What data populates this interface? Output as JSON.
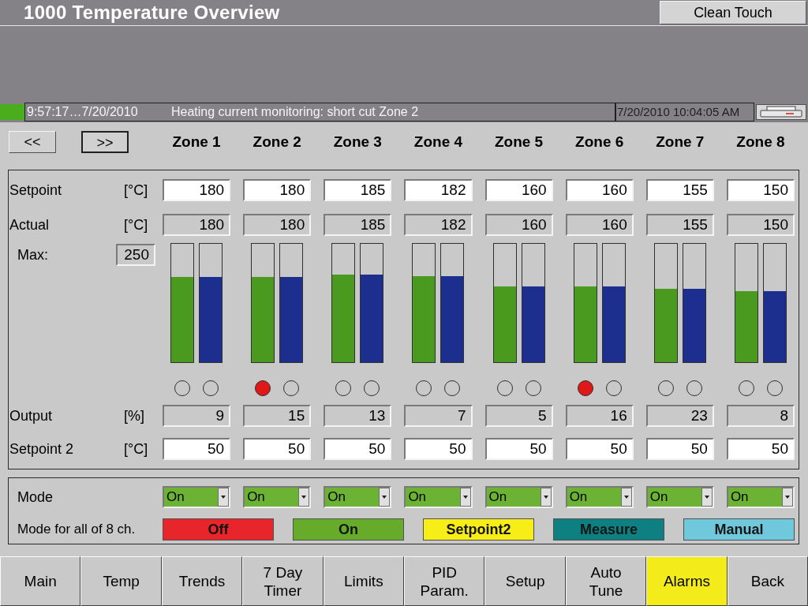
{
  "title_bar": {
    "title": "1000 Temperature Overview",
    "clean_touch_button": "Clean Touch"
  },
  "message_bar": {
    "time": "9:57:17…7/20/2010",
    "message": "Heating current monitoring: short cut Zone 2",
    "date_time": "7/20/2010 10:04:05 AM"
  },
  "page_buttons": [
    {
      "label": "<<",
      "selected": false
    },
    {
      "label": ">>",
      "selected": true
    }
  ],
  "row_labels": {
    "setpoint": {
      "label": "Setpoint",
      "unit": "[°C]"
    },
    "actual": {
      "label": "Actual",
      "unit": "[°C]"
    },
    "output": {
      "label": "Output",
      "unit": "[%]"
    },
    "setpoint_2": {
      "label": "Setpoint 2",
      "unit": "[°C]"
    }
  },
  "max": {
    "label": "Max:",
    "value": "250"
  },
  "zones": [
    {
      "name": "Zone 1",
      "setpoint": "180",
      "actual": "180",
      "bars": [
        {
          "level": 0.72,
          "color": "#4a9a20"
        },
        {
          "level": 0.72,
          "color": "#1c2f8e"
        }
      ],
      "lights": [
        {
          "on": false
        },
        {
          "on": false
        }
      ],
      "output": "9",
      "setpoint_2": "50",
      "mode": "On"
    },
    {
      "name": "Zone 2",
      "setpoint": "180",
      "actual": "180",
      "bars": [
        {
          "level": 0.72,
          "color": "#4a9a20"
        },
        {
          "level": 0.72,
          "color": "#1c2f8e"
        }
      ],
      "lights": [
        {
          "on": true
        },
        {
          "on": false
        }
      ],
      "output": "15",
      "setpoint_2": "50",
      "mode": "On"
    },
    {
      "name": "Zone 3",
      "setpoint": "185",
      "actual": "185",
      "bars": [
        {
          "level": 0.74,
          "color": "#4a9a20"
        },
        {
          "level": 0.74,
          "color": "#1c2f8e"
        }
      ],
      "lights": [
        {
          "on": false
        },
        {
          "on": false
        }
      ],
      "output": "13",
      "setpoint_2": "50",
      "mode": "On"
    },
    {
      "name": "Zone 4",
      "setpoint": "182",
      "actual": "182",
      "bars": [
        {
          "level": 0.73,
          "color": "#4a9a20"
        },
        {
          "level": 0.73,
          "color": "#1c2f8e"
        }
      ],
      "lights": [
        {
          "on": false
        },
        {
          "on": false
        }
      ],
      "output": "7",
      "setpoint_2": "50",
      "mode": "On"
    },
    {
      "name": "Zone 5",
      "setpoint": "160",
      "actual": "160",
      "bars": [
        {
          "level": 0.64,
          "color": "#4a9a20"
        },
        {
          "level": 0.64,
          "color": "#1c2f8e"
        }
      ],
      "lights": [
        {
          "on": false
        },
        {
          "on": false
        }
      ],
      "output": "5",
      "setpoint_2": "50",
      "mode": "On"
    },
    {
      "name": "Zone 6",
      "setpoint": "160",
      "actual": "160",
      "bars": [
        {
          "level": 0.64,
          "color": "#4a9a20"
        },
        {
          "level": 0.64,
          "color": "#1c2f8e"
        }
      ],
      "lights": [
        {
          "on": true
        },
        {
          "on": false
        }
      ],
      "output": "16",
      "setpoint_2": "50",
      "mode": "On"
    },
    {
      "name": "Zone 7",
      "setpoint": "155",
      "actual": "155",
      "bars": [
        {
          "level": 0.62,
          "color": "#4a9a20"
        },
        {
          "level": 0.62,
          "color": "#1c2f8e"
        }
      ],
      "lights": [
        {
          "on": false
        },
        {
          "on": false
        }
      ],
      "output": "23",
      "setpoint_2": "50",
      "mode": "On"
    },
    {
      "name": "Zone 8",
      "setpoint": "150",
      "actual": "150",
      "bars": [
        {
          "level": 0.6,
          "color": "#4a9a20"
        },
        {
          "level": 0.6,
          "color": "#1c2f8e"
        }
      ],
      "lights": [
        {
          "on": false
        },
        {
          "on": false
        }
      ],
      "output": "8",
      "setpoint_2": "50",
      "mode": "On"
    }
  ],
  "mode_panel": {
    "mode_label": "Mode",
    "all_label": "Mode for all of 8 ch.",
    "all_buttons": [
      {
        "label": "Off",
        "color": "#e8252a"
      },
      {
        "label": "On",
        "color": "#66ac2a"
      },
      {
        "label": "Setpoint2",
        "color": "#f6ee16"
      },
      {
        "label": "Measure",
        "color": "#0f8082"
      },
      {
        "label": "Manual",
        "color": "#70c8dc"
      }
    ]
  },
  "nav_tabs": [
    {
      "label": "Main",
      "selected": false
    },
    {
      "label": "Temp",
      "selected": false
    },
    {
      "label": "Trends",
      "selected": false
    },
    {
      "label": "7 Day Timer",
      "selected": false
    },
    {
      "label": "Limits",
      "selected": false
    },
    {
      "label": "PID Param.",
      "selected": false
    },
    {
      "label": "Setup",
      "selected": false
    },
    {
      "label": "Auto Tune",
      "selected": false
    },
    {
      "label": "Alarms",
      "selected": true
    },
    {
      "label": "Back",
      "selected": false
    }
  ]
}
